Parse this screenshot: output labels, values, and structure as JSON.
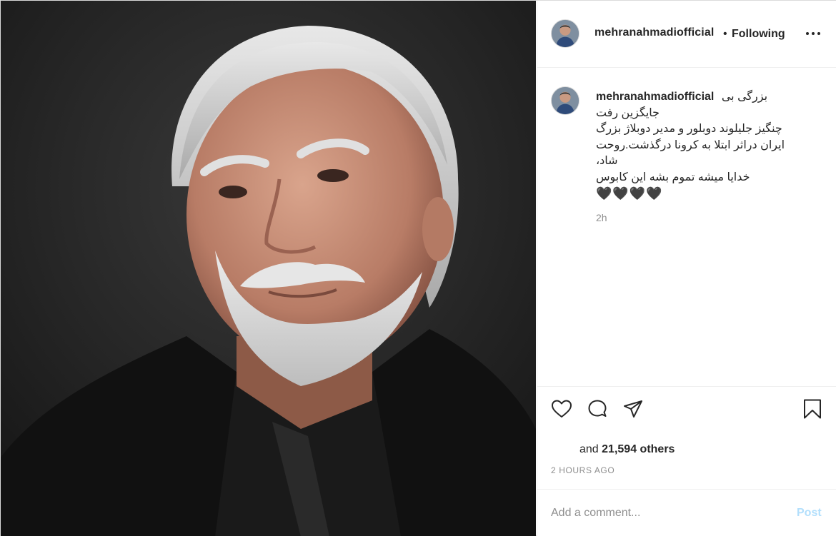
{
  "post": {
    "image_alt": "Portrait of an elderly man with white hair and beard in a black jacket"
  },
  "header": {
    "username": "mehranahmadiofficial",
    "separator": "•",
    "follow_label": "Following"
  },
  "caption": {
    "username": "mehranahmadiofficial",
    "line1": "بزرگی بی",
    "line2": "جایگزین رفت",
    "line3": "چنگیز جلیلوند دوبلور و مدیر دوبلاژ بزرگ",
    "line4": "ایران دراثر ابتلا به کرونا درگذشت.روحت",
    "line5": "شاد،",
    "line6": "خدایا میشه تموم بشه این کابوس",
    "hearts": "🖤🖤🖤🖤",
    "time": "2h"
  },
  "actions": {
    "like_icon": "heart-outline-icon",
    "comment_icon": "comment-bubble-icon",
    "share_icon": "paper-plane-icon",
    "save_icon": "bookmark-icon"
  },
  "likes": {
    "prefix": "and",
    "count_text": "21,594 others"
  },
  "timestamp": "2 HOURS AGO",
  "comment": {
    "placeholder": "Add a comment...",
    "post_label": "Post"
  },
  "colors": {
    "post_disabled": "#b2dffc",
    "muted": "#8e8e8e",
    "text": "#262626",
    "border": "#efefef"
  }
}
